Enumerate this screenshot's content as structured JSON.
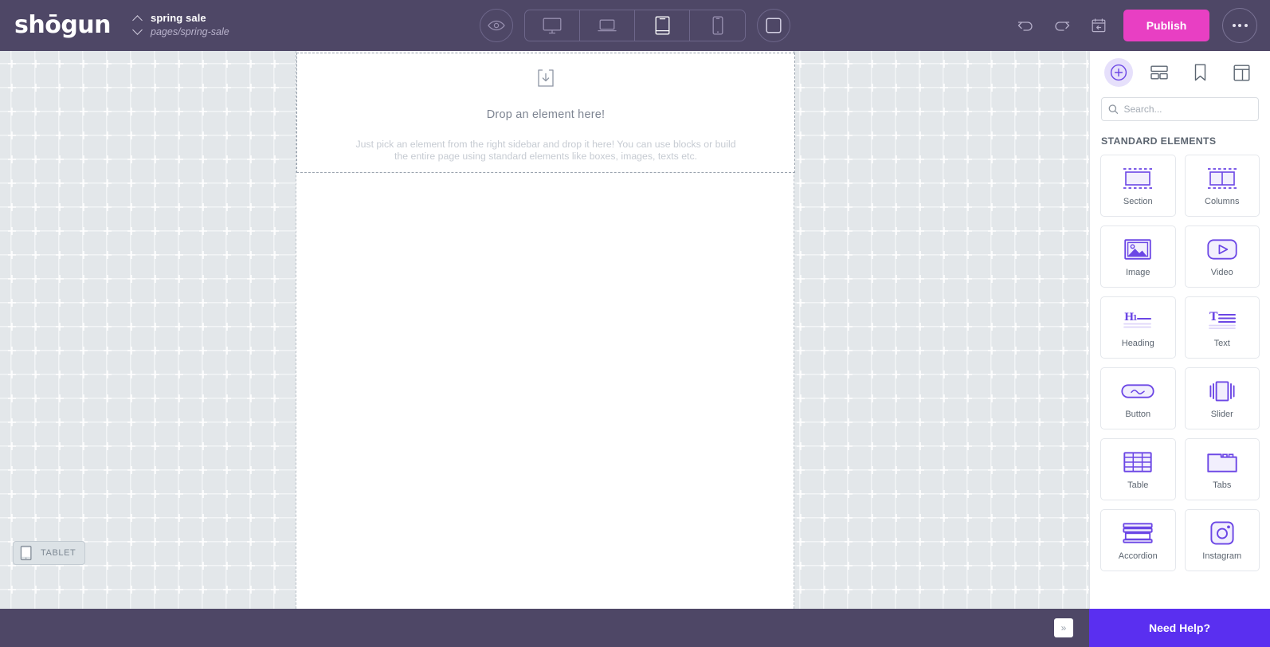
{
  "brand": {
    "logo_text": "shōgun",
    "accent_purple": "#6b46e5",
    "accent_pink": "#e83fc3",
    "header_bg": "#4e4766"
  },
  "header": {
    "page_title": "spring sale",
    "page_path": "pages/spring-sale",
    "page_switcher_icon": "chevron-up-down-icon",
    "preview_icon": "eye-icon",
    "devices": [
      {
        "name": "desktop",
        "icon": "desktop-icon",
        "active": false
      },
      {
        "name": "laptop",
        "icon": "laptop-icon",
        "active": false
      },
      {
        "name": "tablet",
        "icon": "tablet-icon",
        "active": true
      },
      {
        "name": "mobile",
        "icon": "mobile-icon",
        "active": false
      }
    ],
    "fullscreen_icon": "frame-icon",
    "undo_icon": "undo-arrow-icon",
    "redo_icon": "redo-arrow-icon",
    "history_icon": "restore-history-icon",
    "publish_label": "Publish",
    "more_icon": "ellipsis-icon"
  },
  "canvas": {
    "dropzone": {
      "icon": "drop-download-icon",
      "title": "Drop an element here!",
      "subtitle": "Just pick an element from the right sidebar and drop it here! You can use blocks or build the entire page using standard elements like boxes, images, texts etc."
    },
    "viewport_badge": {
      "label": "TABLET",
      "icon": "tablet-icon"
    }
  },
  "sidebar": {
    "tabs": [
      {
        "name": "add-elements",
        "icon": "plus-circle-icon",
        "active": true
      },
      {
        "name": "layout-blocks",
        "icon": "layout-rows-icon",
        "active": false
      },
      {
        "name": "saved-bookmarks",
        "icon": "bookmark-icon",
        "active": false
      },
      {
        "name": "page-templates",
        "icon": "template-icon",
        "active": false
      }
    ],
    "search": {
      "placeholder": "Search...",
      "value": "",
      "icon": "search-icon"
    },
    "section_heading": "STANDARD ELEMENTS",
    "elements": [
      {
        "label": "Section",
        "icon": "section-icon"
      },
      {
        "label": "Columns",
        "icon": "columns-icon"
      },
      {
        "label": "Image",
        "icon": "image-icon"
      },
      {
        "label": "Video",
        "icon": "video-icon"
      },
      {
        "label": "Heading",
        "icon": "heading-h1-icon"
      },
      {
        "label": "Text",
        "icon": "text-lines-icon"
      },
      {
        "label": "Button",
        "icon": "button-icon"
      },
      {
        "label": "Slider",
        "icon": "slider-carousel-icon"
      },
      {
        "label": "Table",
        "icon": "table-grid-icon"
      },
      {
        "label": "Tabs",
        "icon": "tabs-folder-icon"
      },
      {
        "label": "Accordion",
        "icon": "accordion-icon"
      },
      {
        "label": "Instagram",
        "icon": "instagram-icon"
      }
    ]
  },
  "footer": {
    "expand_label": "»",
    "need_help_label": "Need Help?"
  }
}
